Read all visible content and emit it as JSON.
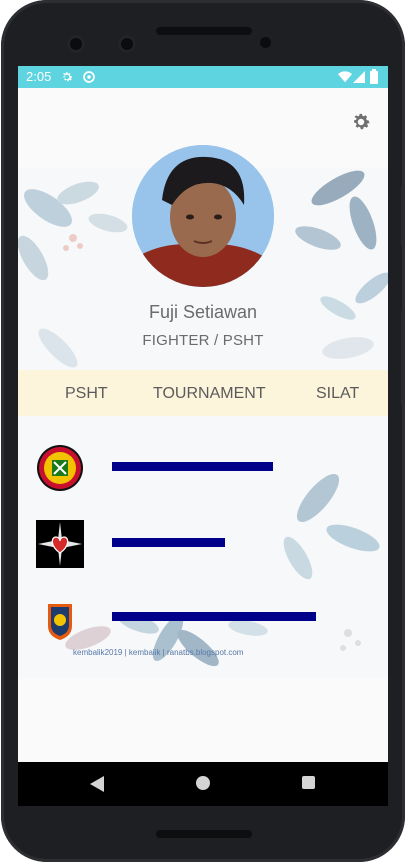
{
  "status_bar": {
    "time": "2:05",
    "color": "#5ed4e0",
    "icons": [
      "settings-icon",
      "sync-icon",
      "wifi-icon",
      "signal-icon",
      "battery-icon"
    ]
  },
  "toolbar": {
    "settings_icon": "gear-icon"
  },
  "profile": {
    "name": "Fuji Setiawan",
    "role": "FIGHTER / PSHT"
  },
  "tabs": [
    {
      "label": "PSHT"
    },
    {
      "label": "TOURNAMENT"
    },
    {
      "label": "SILAT"
    }
  ],
  "items": [
    {
      "logo": "psht-emblem-icon",
      "bar_fraction": 0.43
    },
    {
      "logo": "heart-star-emblem-icon",
      "bar_fraction": 0.25
    },
    {
      "logo": "shield-emblem-icon",
      "bar_fraction": 0.59
    }
  ],
  "background_watermark": "kembalik2019 | kembalik | ranatbs.blogspot.com",
  "nav_bar": {
    "back_icon": "back-triangle-icon",
    "home_icon": "home-circle-icon",
    "recent_icon": "recent-square-icon"
  },
  "colors": {
    "tab_bar_bg": "#fdf4dc",
    "bar_color": "#00008b",
    "accent": "#5ed4e0"
  }
}
